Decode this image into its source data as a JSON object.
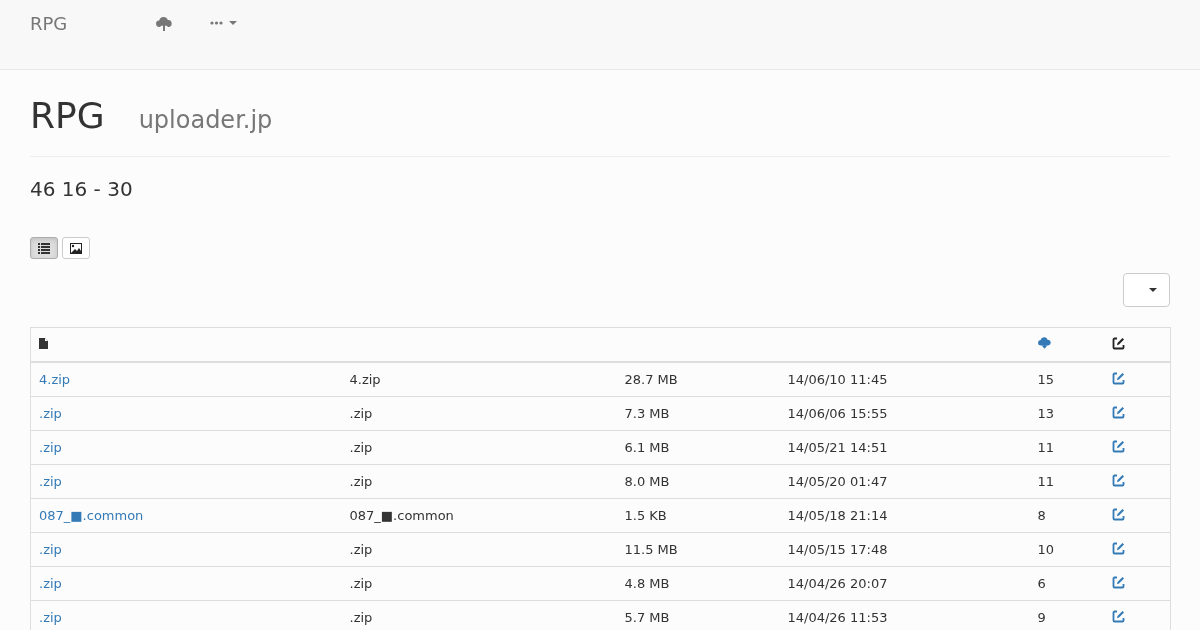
{
  "navbar": {
    "brand": "RPG"
  },
  "header": {
    "title": "RPG",
    "subtitle": "uploader.jp"
  },
  "summary": "46  16 - 30",
  "view_buttons": [
    {
      "kind": "list",
      "selected": true
    },
    {
      "kind": "image",
      "selected": false
    }
  ],
  "rows": [
    {
      "link": "4.zip",
      "name": "4.zip",
      "size": "28.7 MB",
      "date": "14/06/10 11:45",
      "downloads": "15"
    },
    {
      "link": ".zip",
      "name": ".zip",
      "size": "7.3 MB",
      "date": "14/06/06 15:55",
      "downloads": "13"
    },
    {
      "link": ".zip",
      "name": ".zip",
      "size": "6.1 MB",
      "date": "14/05/21 14:51",
      "downloads": "11"
    },
    {
      "link": ".zip",
      "name": ".zip",
      "size": "8.0 MB",
      "date": "14/05/20 01:47",
      "downloads": "11"
    },
    {
      "link": "087_■.common",
      "name": "087_■.common",
      "size": "1.5 KB",
      "date": "14/05/18 21:14",
      "downloads": "8"
    },
    {
      "link": ".zip",
      "name": ".zip",
      "size": "11.5 MB",
      "date": "14/05/15 17:48",
      "downloads": "10"
    },
    {
      "link": ".zip",
      "name": ".zip",
      "size": "4.8 MB",
      "date": "14/04/26 20:07",
      "downloads": "6"
    },
    {
      "link": ".zip",
      "name": ".zip",
      "size": "5.7 MB",
      "date": "14/04/26 11:53",
      "downloads": "9"
    }
  ]
}
